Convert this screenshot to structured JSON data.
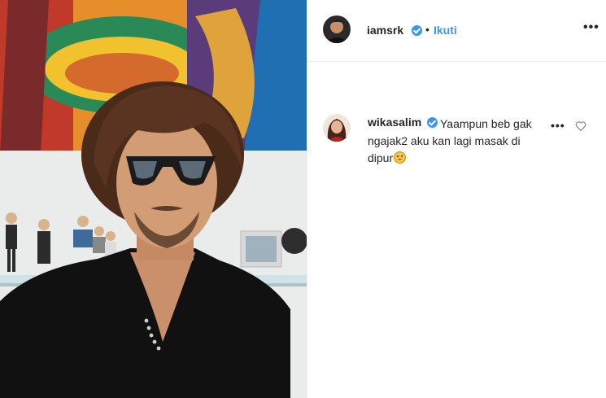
{
  "post": {
    "author": {
      "username": "iamsrk",
      "verified": true,
      "follow_label": "Ikuti",
      "separator": "•"
    },
    "more_options_icon": "more-horizontal-icon",
    "media_description_icon": "photo"
  },
  "comments": [
    {
      "username": "wikasalim",
      "verified": true,
      "text": "Yaampun beb gak ngajak2 aku kan lagi masak di dipur",
      "emoji": "worried-face",
      "actions_icon": "more-horizontal-icon",
      "like_icon": "heart-outline-icon"
    }
  ],
  "colors": {
    "link_blue": "#3897f0",
    "text": "#262626",
    "divider": "#efefef"
  }
}
